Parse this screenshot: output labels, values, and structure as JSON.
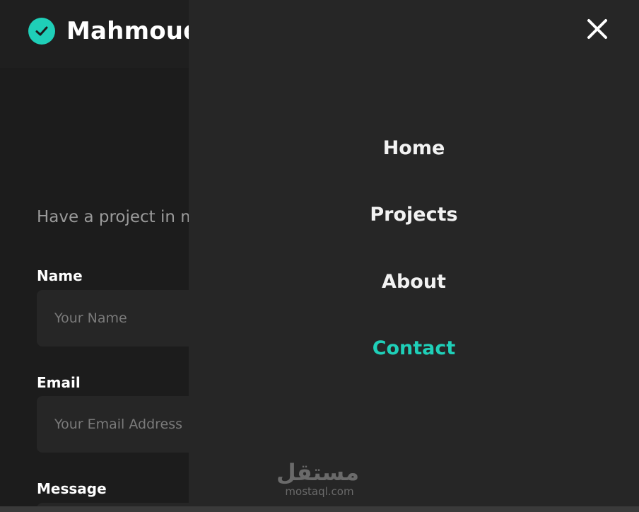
{
  "header": {
    "brand_name": "Mahmoud"
  },
  "form": {
    "intro": "Have a project in m",
    "name_label": "Name",
    "name_placeholder": "Your Name",
    "email_label": "Email",
    "email_placeholder": "Your Email Address",
    "message_label": "Message"
  },
  "menu": {
    "items": [
      {
        "label": "Home",
        "active": false
      },
      {
        "label": "Projects",
        "active": false
      },
      {
        "label": "About",
        "active": false
      },
      {
        "label": "Contact",
        "active": true
      }
    ]
  },
  "watermark": {
    "arabic": "مستقل",
    "latin": "mostaql.com"
  },
  "colors": {
    "accent": "#1fcfb8",
    "background": "#1c1c1c",
    "panel": "#262626"
  },
  "icons": {
    "brand": "check-circle-icon",
    "close": "close-icon"
  }
}
